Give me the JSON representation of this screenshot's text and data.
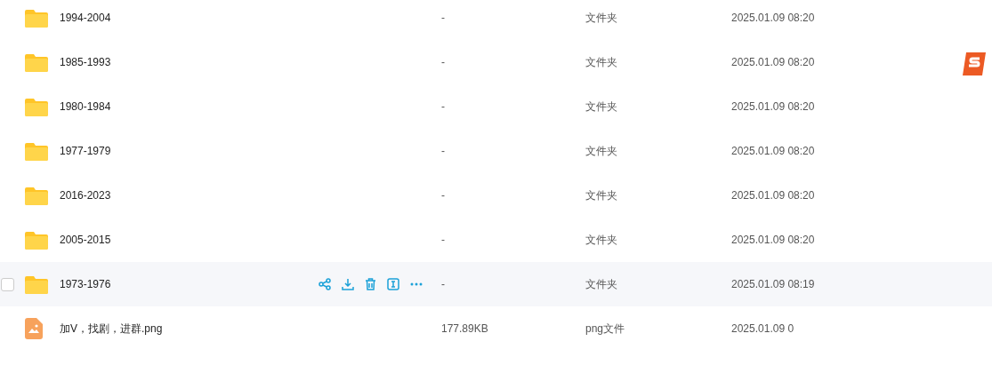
{
  "rows": [
    {
      "kind": "folder",
      "name": "1994-2004",
      "size": "-",
      "type": "文件夹",
      "date": "2025.01.09 08:20",
      "hovered": false
    },
    {
      "kind": "folder",
      "name": "1985-1993",
      "size": "-",
      "type": "文件夹",
      "date": "2025.01.09 08:20",
      "hovered": false
    },
    {
      "kind": "folder",
      "name": "1980-1984",
      "size": "-",
      "type": "文件夹",
      "date": "2025.01.09 08:20",
      "hovered": false
    },
    {
      "kind": "folder",
      "name": "1977-1979",
      "size": "-",
      "type": "文件夹",
      "date": "2025.01.09 08:20",
      "hovered": false
    },
    {
      "kind": "folder",
      "name": "2016-2023",
      "size": "-",
      "type": "文件夹",
      "date": "2025.01.09 08:20",
      "hovered": false
    },
    {
      "kind": "folder",
      "name": "2005-2015",
      "size": "-",
      "type": "文件夹",
      "date": "2025.01.09 08:20",
      "hovered": false
    },
    {
      "kind": "folder",
      "name": "1973-1976",
      "size": "-",
      "type": "文件夹",
      "date": "2025.01.09 08:19",
      "hovered": true
    },
    {
      "kind": "image",
      "name": "加V，找剧，进群.png",
      "size": "177.89KB",
      "type": "png文件",
      "date": "2025.01.09 0",
      "hovered": false
    }
  ]
}
